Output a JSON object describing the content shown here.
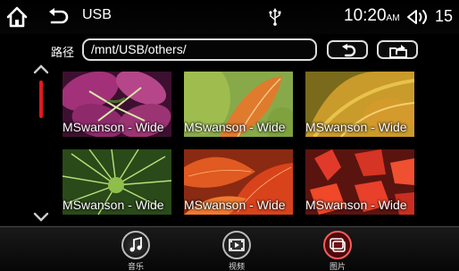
{
  "status": {
    "title": "USB",
    "time": "10:20",
    "ampm": "AM",
    "volume": "15"
  },
  "path": {
    "label": "路径",
    "value": "/mnt/USB/others/"
  },
  "thumbnails": [
    {
      "caption": "MSwanson - Wide"
    },
    {
      "caption": "MSwanson - Wide"
    },
    {
      "caption": "MSwanson - Wide"
    },
    {
      "caption": "MSwanson - Wide"
    },
    {
      "caption": "MSwanson - Wide"
    },
    {
      "caption": "MSwanson - Wide"
    }
  ],
  "dock": {
    "music": "音乐",
    "video": "视频",
    "pictures": "图片",
    "active": "pictures"
  },
  "colors": {
    "accent": "#e0191f"
  },
  "icons": [
    "home-icon",
    "back-icon",
    "usb-icon",
    "volume-icon",
    "up-folder-icon",
    "root-folder-icon",
    "music-icon",
    "video-icon",
    "pictures-icon"
  ]
}
